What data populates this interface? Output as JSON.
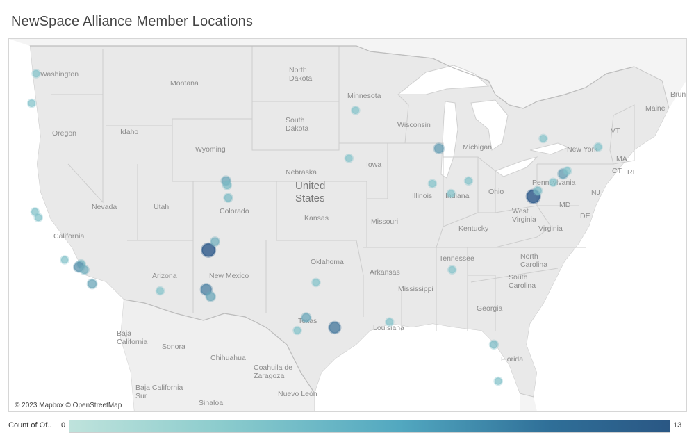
{
  "title": "NewSpace Alliance Member Locations",
  "attribution": "© 2023 Mapbox © OpenStreetMap",
  "legend": {
    "title": "Count of Of..",
    "min": "0",
    "max": "13",
    "color_low": "#bfe3dc",
    "color_high": "#2a5784"
  },
  "labels": {
    "washington": "Washington",
    "oregon": "Oregon",
    "idaho": "Idaho",
    "montana": "Montana",
    "wyoming": "Wyoming",
    "nevada": "Nevada",
    "utah": "Utah",
    "california": "California",
    "colorado": "Colorado",
    "arizona": "Arizona",
    "new_mexico": "New Mexico",
    "north_dakota": "North\nDakota",
    "south_dakota": "South\nDakota",
    "nebraska": "Nebraska",
    "kansas": "Kansas",
    "oklahoma": "Oklahoma",
    "texas": "Texas",
    "minnesota": "Minnesota",
    "iowa": "Iowa",
    "missouri": "Missouri",
    "arkansas": "Arkansas",
    "louisiana": "Louisiana",
    "wisconsin": "Wisconsin",
    "illinois": "Illinois",
    "michigan": "Michigan",
    "indiana": "Indiana",
    "ohio": "Ohio",
    "kentucky": "Kentucky",
    "tennessee": "Tennessee",
    "mississippi": "Mississippi",
    "georgia": "Georgia",
    "florida": "Florida",
    "south_carolina": "South\nCarolina",
    "north_carolina": "North\nCarolina",
    "virginia": "Virginia",
    "west_virginia": "West\nVirginia",
    "pennsylvania": "Pennsylvania",
    "new_york": "New York",
    "maine": "Maine",
    "vt": "VT",
    "ma": "MA",
    "ct": "CT",
    "ri": "RI",
    "nj": "NJ",
    "md": "MD",
    "de": "DE",
    "brun": "Brun",
    "united_states": "United\nStates",
    "baja_california": "Baja\nCalifornia",
    "sonora": "Sonora",
    "chihuahua": "Chihuahua",
    "coahuila": "Coahuila de\nZaragoza",
    "nuevo_leon": "Nuevo León",
    "baja_california_sur": "Baja California\nSur",
    "sinaloa": "Sinaloa"
  },
  "points": [
    {
      "lon": -122.3,
      "lat": 47.6,
      "count": 1
    },
    {
      "lon": -122.7,
      "lat": 45.5,
      "count": 1
    },
    {
      "lon": -122.4,
      "lat": 37.8,
      "count": 1
    },
    {
      "lon": -122.1,
      "lat": 37.4,
      "count": 1
    },
    {
      "lon": -119.7,
      "lat": 34.4,
      "count": 1
    },
    {
      "lon": -118.2,
      "lat": 34.1,
      "count": 2
    },
    {
      "lon": -118.4,
      "lat": 33.9,
      "count": 6
    },
    {
      "lon": -117.9,
      "lat": 33.7,
      "count": 3
    },
    {
      "lon": -117.2,
      "lat": 32.7,
      "count": 4
    },
    {
      "lon": -111.0,
      "lat": 32.2,
      "count": 1
    },
    {
      "lon": -105.0,
      "lat": 40.0,
      "count": 4
    },
    {
      "lon": -104.9,
      "lat": 39.7,
      "count": 2
    },
    {
      "lon": -104.8,
      "lat": 38.8,
      "count": 2
    },
    {
      "lon": -106.6,
      "lat": 35.1,
      "count": 13
    },
    {
      "lon": -106.0,
      "lat": 35.7,
      "count": 3
    },
    {
      "lon": -106.8,
      "lat": 32.3,
      "count": 8
    },
    {
      "lon": -106.4,
      "lat": 31.8,
      "count": 4
    },
    {
      "lon": -96.8,
      "lat": 32.8,
      "count": 1
    },
    {
      "lon": -97.7,
      "lat": 30.3,
      "count": 4
    },
    {
      "lon": -98.5,
      "lat": 29.4,
      "count": 1
    },
    {
      "lon": -95.1,
      "lat": 29.6,
      "count": 9
    },
    {
      "lon": -93.8,
      "lat": 41.6,
      "count": 1
    },
    {
      "lon": -93.2,
      "lat": 45.0,
      "count": 1
    },
    {
      "lon": -85.6,
      "lat": 42.3,
      "count": 5
    },
    {
      "lon": -86.2,
      "lat": 39.8,
      "count": 1
    },
    {
      "lon": -84.5,
      "lat": 39.1,
      "count": 1
    },
    {
      "lon": -82.9,
      "lat": 40.0,
      "count": 1
    },
    {
      "lon": -84.4,
      "lat": 33.7,
      "count": 1
    },
    {
      "lon": -80.6,
      "lat": 28.4,
      "count": 2
    },
    {
      "lon": -80.2,
      "lat": 25.8,
      "count": 1
    },
    {
      "lon": -77.0,
      "lat": 38.9,
      "count": 13
    },
    {
      "lon": -76.6,
      "lat": 39.3,
      "count": 2
    },
    {
      "lon": -75.2,
      "lat": 39.9,
      "count": 1
    },
    {
      "lon": -74.3,
      "lat": 40.5,
      "count": 5
    },
    {
      "lon": -73.9,
      "lat": 40.7,
      "count": 1
    },
    {
      "lon": -76.1,
      "lat": 43.0,
      "count": 1
    },
    {
      "lon": -71.1,
      "lat": 42.4,
      "count": 1
    },
    {
      "lon": -90.1,
      "lat": 30.0,
      "count": 1
    }
  ]
}
